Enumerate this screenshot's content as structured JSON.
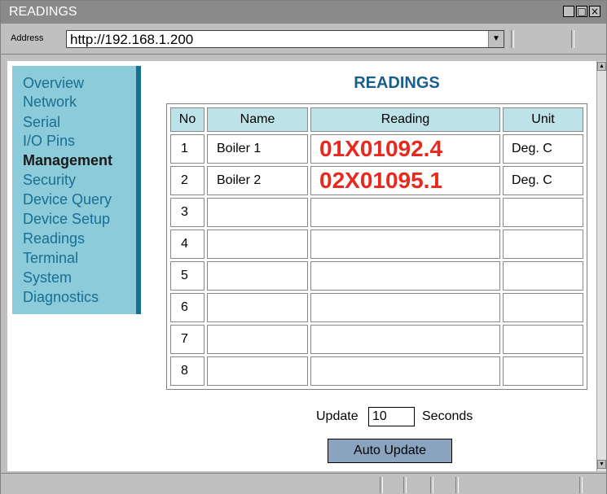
{
  "window": {
    "title": "READINGS",
    "buttons": {
      "minimize": "_",
      "maximize": "□",
      "close": "×"
    }
  },
  "address": {
    "label": "Address",
    "value": "http://192.168.1.200",
    "dropdown_glyph": "▼"
  },
  "sidebar": {
    "items": [
      {
        "label": "Overview",
        "active": false
      },
      {
        "label": "Network",
        "active": false
      },
      {
        "label": "Serial",
        "active": false
      },
      {
        "label": "I/O Pins",
        "active": false
      },
      {
        "label": "Management",
        "active": true
      },
      {
        "label": "Security",
        "active": false
      },
      {
        "label": "Device Query",
        "active": false
      },
      {
        "label": "Device Setup",
        "active": false
      },
      {
        "label": "Readings",
        "active": false
      },
      {
        "label": "Terminal",
        "active": false
      },
      {
        "label": "System",
        "active": false
      },
      {
        "label": "Diagnostics",
        "active": false
      }
    ]
  },
  "main": {
    "title": "READINGS",
    "table": {
      "headers": [
        "No",
        "Name",
        "Reading",
        "Unit"
      ],
      "rows": [
        {
          "no": "1",
          "name": "Boiler 1",
          "reading": "01X01092.4",
          "unit": "Deg. C"
        },
        {
          "no": "2",
          "name": "Boiler 2",
          "reading": "02X01095.1",
          "unit": "Deg. C"
        },
        {
          "no": "3",
          "name": "",
          "reading": "",
          "unit": ""
        },
        {
          "no": "4",
          "name": "",
          "reading": "",
          "unit": ""
        },
        {
          "no": "5",
          "name": "",
          "reading": "",
          "unit": ""
        },
        {
          "no": "6",
          "name": "",
          "reading": "",
          "unit": ""
        },
        {
          "no": "7",
          "name": "",
          "reading": "",
          "unit": ""
        },
        {
          "no": "8",
          "name": "",
          "reading": "",
          "unit": ""
        }
      ]
    },
    "update": {
      "prefix": "Update",
      "value": "10",
      "suffix": "Seconds",
      "button_label": "Auto Update"
    }
  },
  "colors": {
    "sidebar_bg": "#8ccbd9",
    "sidebar_accent": "#1a6e92",
    "nav_link": "#1a6e92",
    "reading_value": "#e8291f",
    "header_bg": "#bde3e8",
    "button_bg": "#8aa3bf"
  }
}
